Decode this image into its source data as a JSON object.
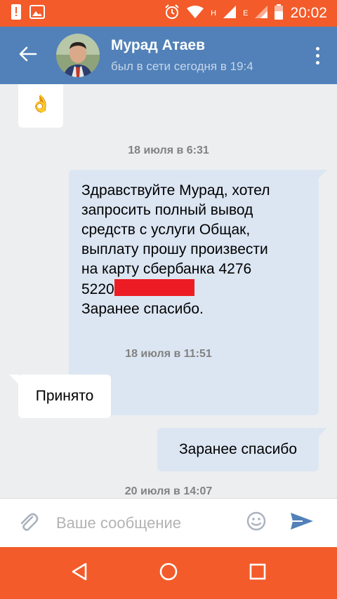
{
  "status_bar": {
    "time": "20:02",
    "network_letter_1": "H",
    "network_letter_2": "E",
    "color": "#f35b2a"
  },
  "header": {
    "name": "Мурад Атаев",
    "status": "был в сети сегодня в 19:4",
    "color": "#5181b8"
  },
  "messages": [
    {
      "type": "in",
      "text": "👌"
    },
    {
      "type": "date",
      "text": "18 июля в 6:31"
    },
    {
      "type": "out",
      "lines": [
        "Здравствуйте Мурад, хотел",
        "запросить полный вывод",
        "средств с услуги Общак,",
        "выплату прошу произвести",
        "на карту сбербанка 4276"
      ],
      "redacted_prefix": "5220",
      "closing": "Заранее спасибо."
    },
    {
      "type": "date",
      "text": "18 июля в 11:51"
    },
    {
      "type": "in",
      "text": "Принято"
    },
    {
      "type": "out",
      "text": "Заранее спасибо"
    },
    {
      "type": "date",
      "text": "20 июля в 14:07"
    }
  ],
  "composer": {
    "placeholder": "Ваше сообщение",
    "value": ""
  },
  "icons": {
    "back": "arrow-left-icon",
    "menu": "more-vertical-icon",
    "attach": "paperclip-icon",
    "emoji": "smiley-icon",
    "send": "send-icon",
    "nav_back": "triangle-back-icon",
    "nav_home": "circle-home-icon",
    "nav_recents": "square-recents-icon"
  }
}
